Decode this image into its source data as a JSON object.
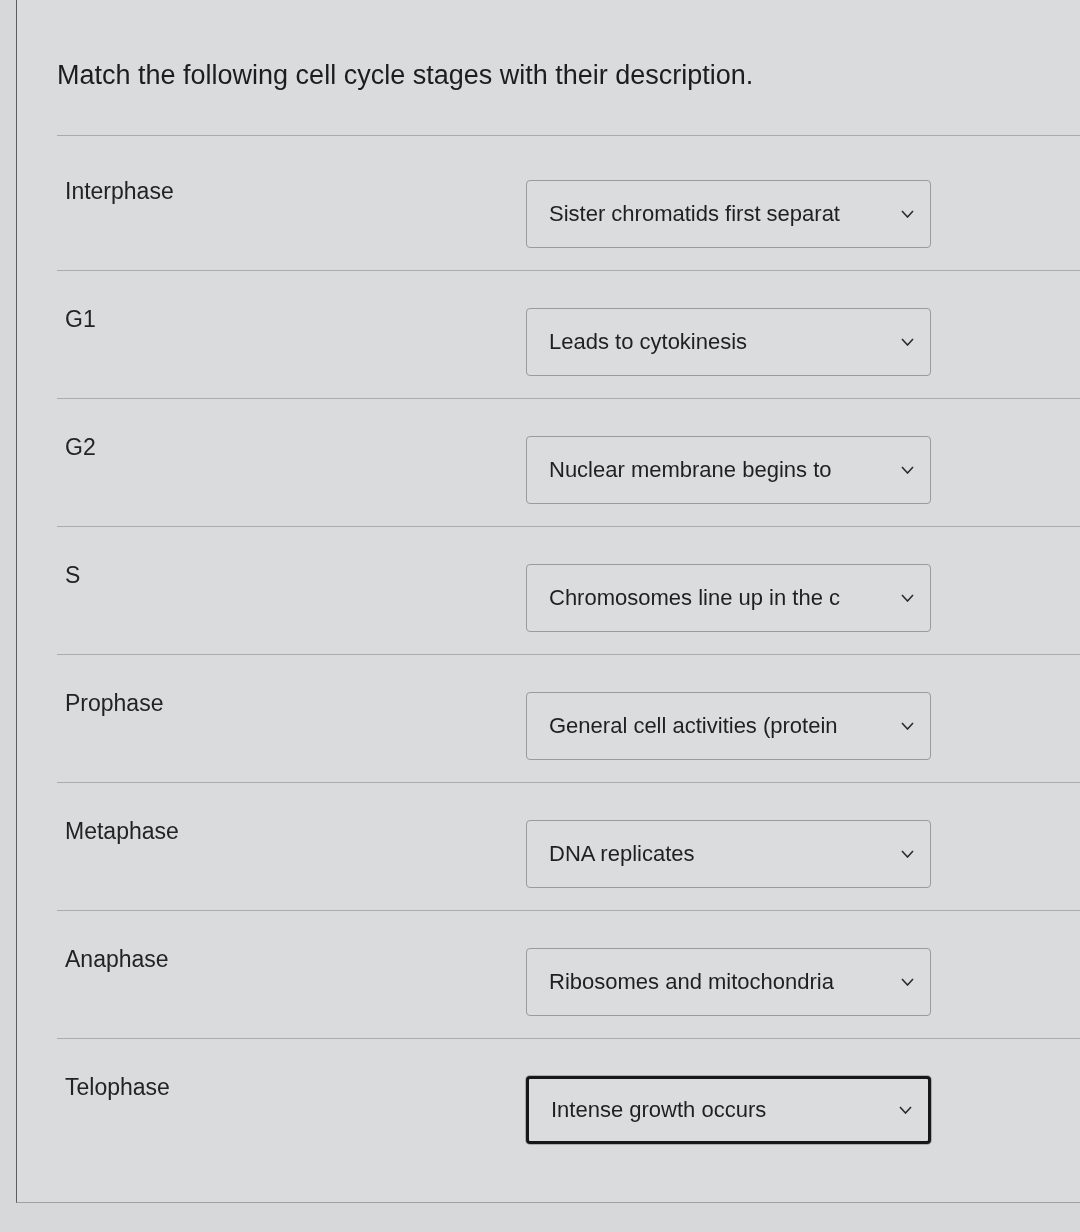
{
  "question": {
    "text": "Match the following cell cycle stages with their description."
  },
  "rows": [
    {
      "stage": "Interphase",
      "answer": "Sister chromatids first separat",
      "focused": false
    },
    {
      "stage": "G1",
      "answer": "Leads to cytokinesis",
      "focused": false
    },
    {
      "stage": "G2",
      "answer": "Nuclear membrane begins to",
      "focused": false
    },
    {
      "stage": "S",
      "answer": "Chromosomes line up in the c",
      "focused": false
    },
    {
      "stage": "Prophase",
      "answer": "General cell activities (protein",
      "focused": false
    },
    {
      "stage": "Metaphase",
      "answer": "DNA replicates",
      "focused": false
    },
    {
      "stage": "Anaphase",
      "answer": "Ribosomes and mitochondria",
      "focused": false
    },
    {
      "stage": "Telophase",
      "answer": "Intense growth occurs",
      "focused": true
    }
  ]
}
